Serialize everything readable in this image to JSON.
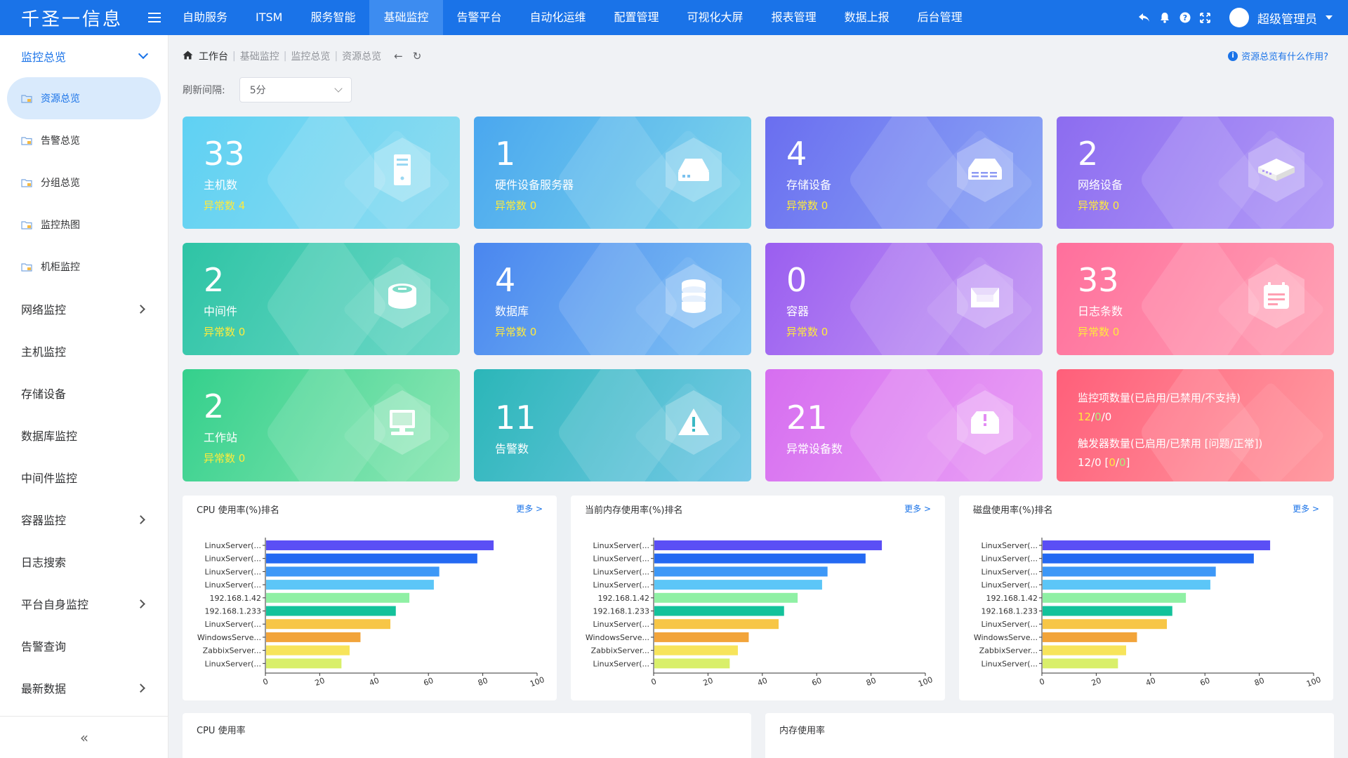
{
  "app": {
    "logo": "千圣一信息"
  },
  "topnav": [
    {
      "label": "自助服务"
    },
    {
      "label": "ITSM"
    },
    {
      "label": "服务智能"
    },
    {
      "label": "基础监控",
      "active": true
    },
    {
      "label": "告警平台"
    },
    {
      "label": "自动化运维"
    },
    {
      "label": "配置管理"
    },
    {
      "label": "可视化大屏"
    },
    {
      "label": "报表管理"
    },
    {
      "label": "数据上报"
    },
    {
      "label": "后台管理"
    }
  ],
  "user": {
    "name": "超级管理员"
  },
  "sidebar": {
    "group": "监控总览",
    "subitems": [
      {
        "label": "资源总览",
        "active": true
      },
      {
        "label": "告警总览"
      },
      {
        "label": "分组总览"
      },
      {
        "label": "监控热图"
      },
      {
        "label": "机柜监控"
      }
    ],
    "items": [
      {
        "label": "网络监控",
        "expandable": true
      },
      {
        "label": "主机监控",
        "expandable": false
      },
      {
        "label": "存储设备",
        "expandable": false
      },
      {
        "label": "数据库监控",
        "expandable": false
      },
      {
        "label": "中间件监控",
        "expandable": false
      },
      {
        "label": "容器监控",
        "expandable": true
      },
      {
        "label": "日志搜索",
        "expandable": false
      },
      {
        "label": "平台自身监控",
        "expandable": true
      },
      {
        "label": "告警查询",
        "expandable": false
      },
      {
        "label": "最新数据",
        "expandable": true
      }
    ],
    "collapse_icon": "«"
  },
  "breadcrumb": {
    "items": [
      "工作台",
      "基础监控",
      "监控总览",
      "资源总览"
    ],
    "back_icon": "←",
    "refresh_icon": "↻"
  },
  "help": {
    "label": "资源总览有什么作用?"
  },
  "refresh": {
    "label": "刷新间隔:",
    "value": "5分"
  },
  "abnormal_label": "异常数",
  "cards": [
    {
      "num": "33",
      "label": "主机数",
      "abnormal": "4",
      "icon": "server-icon"
    },
    {
      "num": "1",
      "label": "硬件设备服务器",
      "abnormal": "0",
      "icon": "hardware-icon"
    },
    {
      "num": "4",
      "label": "存储设备",
      "abnormal": "0",
      "icon": "storage-icon"
    },
    {
      "num": "2",
      "label": "网络设备",
      "abnormal": "0",
      "icon": "network-icon"
    },
    {
      "num": "2",
      "label": "中间件",
      "abnormal": "0",
      "icon": "middleware-icon"
    },
    {
      "num": "4",
      "label": "数据库",
      "abnormal": "0",
      "icon": "database-icon"
    },
    {
      "num": "0",
      "label": "容器",
      "abnormal": "0",
      "icon": "container-icon"
    },
    {
      "num": "33",
      "label": "日志条数",
      "abnormal": "0",
      "icon": "log-icon"
    },
    {
      "num": "2",
      "label": "工作站",
      "abnormal": "0",
      "icon": "workstation-icon"
    },
    {
      "num": "11",
      "label": "告警数",
      "icon": "alert-icon"
    },
    {
      "num": "21",
      "label": "异常设备数",
      "icon": "abnormal-device-icon"
    }
  ],
  "stat_card": {
    "monitor_title": "监控项数量(已启用/已禁用/不支持)",
    "monitor_enabled": "12",
    "monitor_disabled": "0",
    "monitor_unsupported": "0",
    "trigger_title": "触发器数量(已启用/已禁用 [问题/正常])",
    "trigger_enabled": "12",
    "trigger_disabled": "0",
    "trigger_problem": "0",
    "trigger_normal": "0"
  },
  "more_label": "更多 >",
  "bottom_panels": [
    {
      "title": "CPU 使用率"
    },
    {
      "title": "内存使用率"
    }
  ],
  "chart_data": [
    {
      "type": "bar",
      "orientation": "horizontal",
      "title": "CPU 使用率(%)排名",
      "categories": [
        "LinuxServer(...",
        "LinuxServer(...",
        "LinuxServer(...",
        "LinuxServer(...",
        "192.168.1.42",
        "192.168.1.233",
        "LinuxServer(...",
        "WindowsServe...",
        "ZabbixServer...",
        "LinuxServer(..."
      ],
      "values": [
        84,
        78,
        64,
        62,
        53,
        48,
        46,
        35,
        31,
        28
      ],
      "xlim": [
        0,
        100
      ],
      "xticks": [
        0,
        20,
        40,
        60,
        80,
        100
      ],
      "colors": [
        "#5b4ff5",
        "#2469f2",
        "#3d98f7",
        "#5cc6f7",
        "#8ff0a4",
        "#13c29b",
        "#f7c646",
        "#f2a43a",
        "#f7e45b",
        "#d9ef6a"
      ]
    },
    {
      "type": "bar",
      "orientation": "horizontal",
      "title": "当前内存使用率(%)排名",
      "categories": [
        "LinuxServer(...",
        "LinuxServer(...",
        "LinuxServer(...",
        "LinuxServer(...",
        "192.168.1.42",
        "192.168.1.233",
        "LinuxServer(...",
        "WindowsServe...",
        "ZabbixServer...",
        "LinuxServer(..."
      ],
      "values": [
        84,
        78,
        64,
        62,
        53,
        48,
        46,
        35,
        31,
        28
      ],
      "xlim": [
        0,
        100
      ],
      "xticks": [
        0,
        20,
        40,
        60,
        80,
        100
      ],
      "colors": [
        "#5b4ff5",
        "#2469f2",
        "#3d98f7",
        "#5cc6f7",
        "#8ff0a4",
        "#13c29b",
        "#f7c646",
        "#f2a43a",
        "#f7e45b",
        "#d9ef6a"
      ]
    },
    {
      "type": "bar",
      "orientation": "horizontal",
      "title": "磁盘使用率(%)排名",
      "categories": [
        "LinuxServer(...",
        "LinuxServer(...",
        "LinuxServer(...",
        "LinuxServer(...",
        "192.168.1.42",
        "192.168.1.233",
        "LinuxServer(...",
        "WindowsServe...",
        "ZabbixServer...",
        "LinuxServer(..."
      ],
      "values": [
        84,
        78,
        64,
        62,
        53,
        48,
        46,
        35,
        31,
        28
      ],
      "xlim": [
        0,
        100
      ],
      "xticks": [
        0,
        20,
        40,
        60,
        80,
        100
      ],
      "colors": [
        "#5b4ff5",
        "#2469f2",
        "#3d98f7",
        "#5cc6f7",
        "#8ff0a4",
        "#13c29b",
        "#f7c646",
        "#f2a43a",
        "#f7e45b",
        "#d9ef6a"
      ]
    }
  ]
}
